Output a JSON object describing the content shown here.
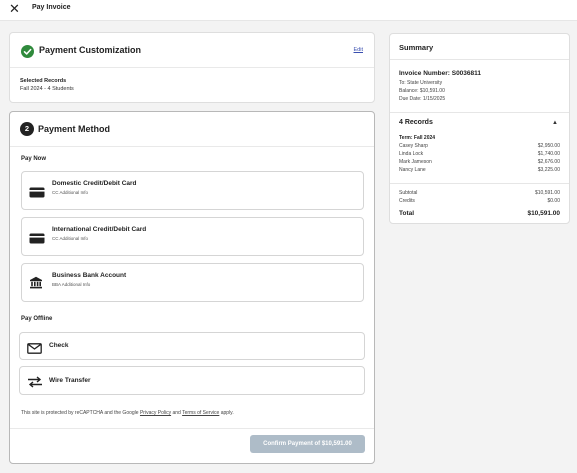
{
  "topbar": {
    "close_icon": "close-icon",
    "title": "Pay Invoice"
  },
  "customization": {
    "title": "Payment Customization",
    "edit_label": "Edit",
    "selected_label": "Selected Records",
    "selected_value": "Fall 2024 - 4 Students",
    "status_color": "#2f8a3c"
  },
  "method": {
    "step": "2",
    "title": "Payment Method",
    "pay_now_label": "Pay Now",
    "pay_offline_label": "Pay Offline",
    "options": [
      {
        "title": "Domestic Credit/Debit Card",
        "sub": "CC Additional Info",
        "icon": "credit-card-icon"
      },
      {
        "title": "International Credit/Debit Card",
        "sub": "CC Additional Info",
        "icon": "credit-card-icon"
      },
      {
        "title": "Business Bank Account",
        "sub": "BBA Additional Info",
        "icon": "bank-icon"
      }
    ],
    "offline": [
      {
        "title": "Check",
        "icon": "envelope-icon"
      },
      {
        "title": "Wire Transfer",
        "icon": "transfer-arrows-icon"
      }
    ],
    "recaptcha": {
      "pre": "This site is protected by reCAPTCHA and the Google ",
      "privacy": "Privacy Policy",
      "and": " and ",
      "terms": "Terms of Service",
      "post": " apply."
    },
    "confirm_label": "Confirm Payment of $10,591.00",
    "confirm_color": "#aebcc8"
  },
  "summary": {
    "title": "Summary",
    "invoice_number": "Invoice Number: S0036811",
    "to": "To: State University",
    "balance": "Balance: $10,591.00",
    "due": "Due Date: 1/15/2025",
    "records_label": "4 Records",
    "term": "Term: Fall 2024",
    "students": [
      {
        "name": "Casey Sharp",
        "amount": "$2,950.00"
      },
      {
        "name": "Linda Lock",
        "amount": "$1,740.00"
      },
      {
        "name": "Mark Jameson",
        "amount": "$2,676.00"
      },
      {
        "name": "Nancy Lane",
        "amount": "$3,225.00"
      }
    ],
    "subtotal_label": "Subtotal",
    "subtotal": "$10,591.00",
    "credits_label": "Credits",
    "credits": "$0.00",
    "total_label": "Total",
    "total": "$10,591.00"
  }
}
